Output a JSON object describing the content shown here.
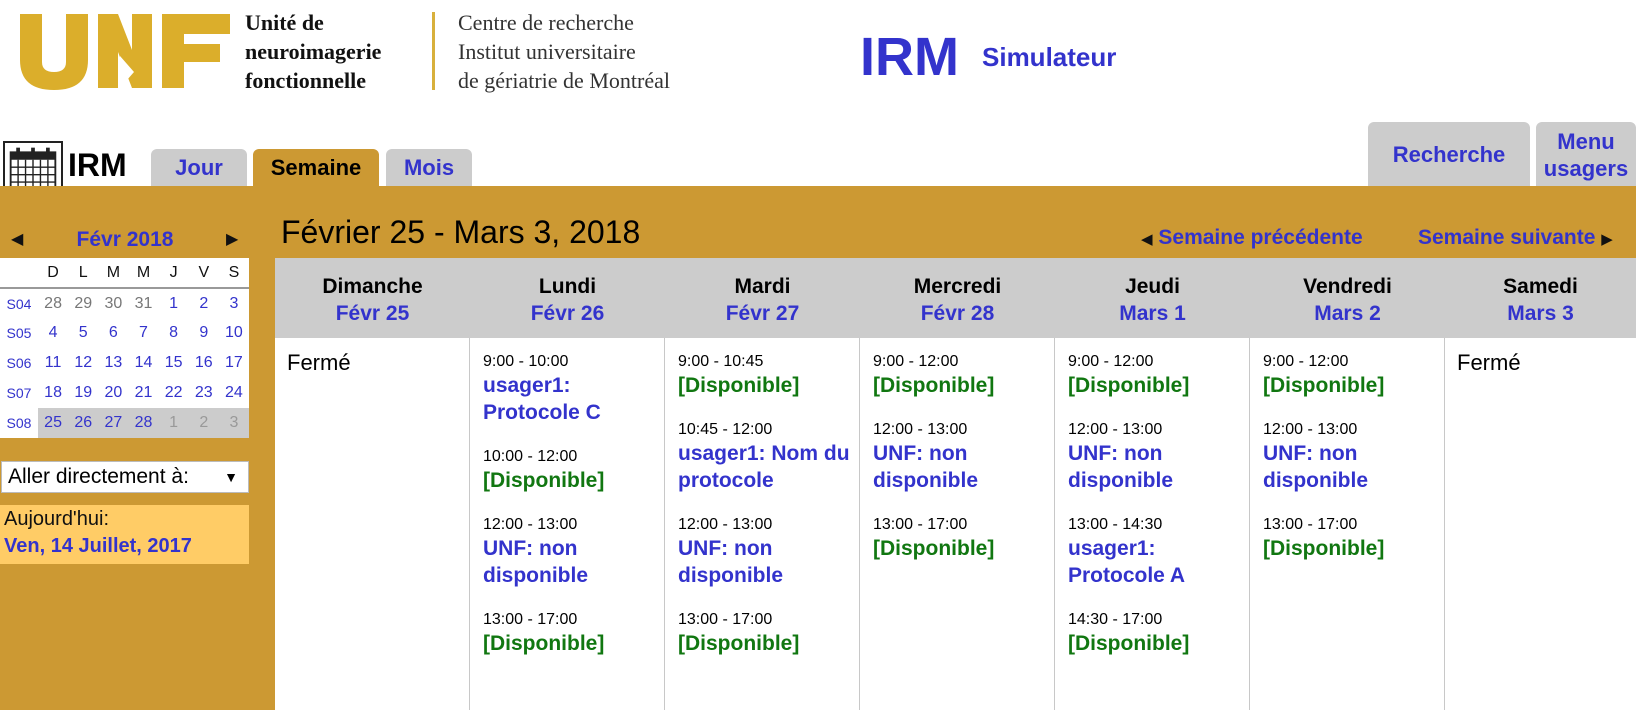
{
  "header": {
    "logo_letters": "UNF",
    "org_lines": [
      "Unité de",
      "neuroimagerie",
      "fonctionnelle"
    ],
    "center_lines": [
      "Centre de recherche",
      "Institut universitaire",
      "de gériatrie de Montréal"
    ],
    "app_title": "IRM",
    "app_subtitle": "Simulateur"
  },
  "toolbar": {
    "calendar_name": "IRM",
    "tabs": [
      {
        "label": "Jour",
        "active": false
      },
      {
        "label": "Semaine",
        "active": true
      },
      {
        "label": "Mois",
        "active": false
      }
    ],
    "search_label": "Recherche",
    "users_menu_label": "Menu usagers"
  },
  "colors": {
    "gold": "#cc9933",
    "link_blue": "#3333cc",
    "available_green": "#117711",
    "tab_grey": "#cccccc",
    "today_yellow": "#ffcc66"
  },
  "mini_calendar": {
    "month": "Févr 2018",
    "prev_icon": "triangle-left-icon",
    "next_icon": "triangle-right-icon",
    "weekday_headers": [
      "D",
      "L",
      "M",
      "M",
      "J",
      "V",
      "S"
    ],
    "weeks": [
      {
        "label": "S04",
        "days": [
          "28",
          "29",
          "30",
          "31",
          "1",
          "2",
          "3"
        ]
      },
      {
        "label": "S05",
        "days": [
          "4",
          "5",
          "6",
          "7",
          "8",
          "9",
          "10"
        ]
      },
      {
        "label": "S06",
        "days": [
          "11",
          "12",
          "13",
          "14",
          "15",
          "16",
          "17"
        ]
      },
      {
        "label": "S07",
        "days": [
          "18",
          "19",
          "20",
          "21",
          "22",
          "23",
          "24"
        ]
      },
      {
        "label": "S08",
        "days": [
          "25",
          "26",
          "27",
          "28",
          "1",
          "2",
          "3"
        ]
      }
    ],
    "goto_label": "Aller directement à:",
    "today_label": "Aujourd'hui:",
    "today_value": "Ven, 14 Juillet, 2017"
  },
  "week": {
    "title": "Février 25 - Mars 3, 2018",
    "prev_label": "Semaine précédente",
    "next_label": "Semaine suivante",
    "days": [
      {
        "name": "Dimanche",
        "date": "Févr 25",
        "closed": "Fermé",
        "slots": []
      },
      {
        "name": "Lundi",
        "date": "Févr 26",
        "slots": [
          {
            "time": "9:00 - 10:00",
            "text": "usager1: Protocole C",
            "status": "busy"
          },
          {
            "time": "10:00 - 12:00",
            "text": "[Disponible]",
            "status": "free"
          },
          {
            "time": "12:00 - 13:00",
            "text": "UNF: non disponible",
            "status": "busy"
          },
          {
            "time": "13:00 - 17:00",
            "text": "[Disponible]",
            "status": "free"
          }
        ]
      },
      {
        "name": "Mardi",
        "date": "Févr 27",
        "slots": [
          {
            "time": "9:00 - 10:45",
            "text": "[Disponible]",
            "status": "free"
          },
          {
            "time": "10:45 - 12:00",
            "text": "usager1: Nom du protocole",
            "status": "busy"
          },
          {
            "time": "12:00 - 13:00",
            "text": "UNF: non disponible",
            "status": "busy"
          },
          {
            "time": "13:00 - 17:00",
            "text": "[Disponible]",
            "status": "free"
          }
        ]
      },
      {
        "name": "Mercredi",
        "date": "Févr 28",
        "slots": [
          {
            "time": "9:00 - 12:00",
            "text": "[Disponible]",
            "status": "free"
          },
          {
            "time": "12:00 - 13:00",
            "text": "UNF: non disponible",
            "status": "busy"
          },
          {
            "time": "13:00 - 17:00",
            "text": "[Disponible]",
            "status": "free"
          }
        ]
      },
      {
        "name": "Jeudi",
        "date": "Mars 1",
        "slots": [
          {
            "time": "9:00 - 12:00",
            "text": "[Disponible]",
            "status": "free"
          },
          {
            "time": "12:00 - 13:00",
            "text": "UNF: non disponible",
            "status": "busy"
          },
          {
            "time": "13:00 - 14:30",
            "text": "usager1: Protocole A",
            "status": "busy"
          },
          {
            "time": "14:30 - 17:00",
            "text": "[Disponible]",
            "status": "free"
          }
        ]
      },
      {
        "name": "Vendredi",
        "date": "Mars 2",
        "slots": [
          {
            "time": "9:00 - 12:00",
            "text": "[Disponible]",
            "status": "free"
          },
          {
            "time": "12:00 - 13:00",
            "text": "UNF: non disponible",
            "status": "busy"
          },
          {
            "time": "13:00 - 17:00",
            "text": "[Disponible]",
            "status": "free"
          }
        ]
      },
      {
        "name": "Samedi",
        "date": "Mars 3",
        "closed": "Fermé",
        "slots": []
      }
    ]
  }
}
